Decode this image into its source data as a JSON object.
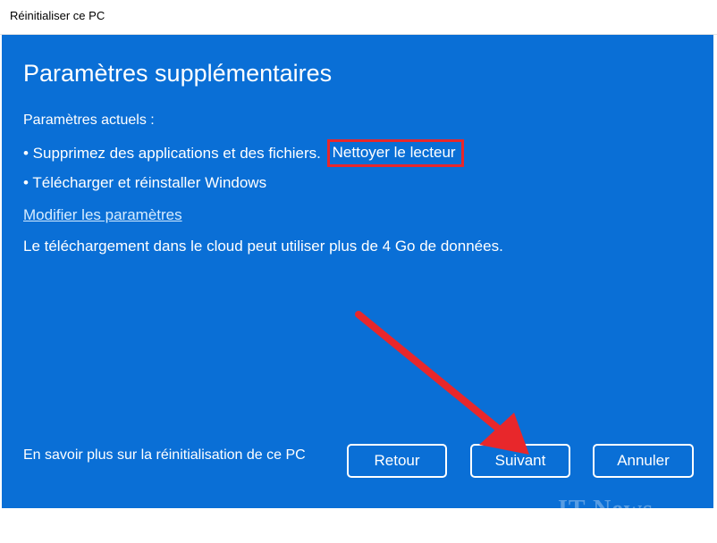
{
  "window": {
    "title": "Réinitialiser ce PC"
  },
  "page": {
    "heading": "Paramètres supplémentaires",
    "current_label": "Paramètres actuels :",
    "bullet_1_text": "•  Supprimez des applications et des fichiers.",
    "bullet_1_highlight": "Nettoyer le lecteur",
    "bullet_2_text": "• Télécharger et réinstaller Windows",
    "change_link": "Modifier les paramètres",
    "cloud_note": "Le téléchargement dans le cloud peut utiliser plus de 4 Go de données.",
    "learn_more": "En savoir plus sur la réinitialisation de ce PC"
  },
  "buttons": {
    "back": "Retour",
    "next": "Suivant",
    "cancel": "Annuler"
  },
  "overlay": {
    "arrow_icon": "annotation-arrow-icon",
    "highlight_color": "#e8272b",
    "watermark": "IT News"
  },
  "colors": {
    "panel_background": "#0a6fd6",
    "text": "#ffffff",
    "annotation": "#e8272b"
  }
}
